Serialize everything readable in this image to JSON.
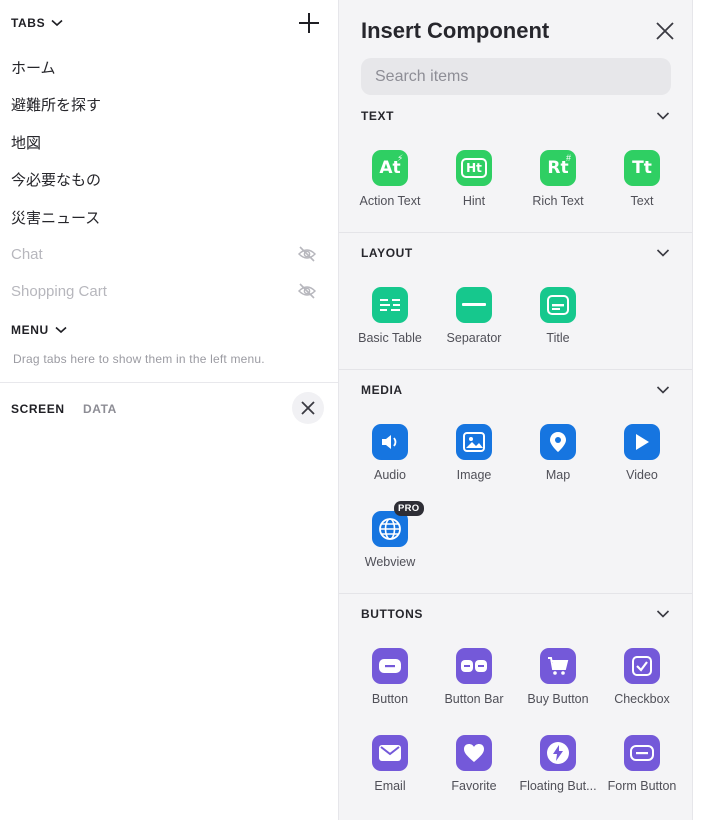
{
  "left": {
    "tabs_label": "TABS",
    "tabs": [
      {
        "label": "ホーム",
        "hidden": false
      },
      {
        "label": "避難所を探す",
        "hidden": false
      },
      {
        "label": "地図",
        "hidden": false
      },
      {
        "label": "今必要なもの",
        "hidden": false
      },
      {
        "label": "災害ニュース",
        "hidden": false
      },
      {
        "label": "Chat",
        "hidden": true,
        "icon": "eye-off-icon"
      },
      {
        "label": "Shopping Cart",
        "hidden": true,
        "icon": "eye-off-icon"
      }
    ],
    "menu_label": "MENU",
    "menu_hint": "Drag tabs here to show them in the left menu.",
    "screen_tab": "SCREEN",
    "data_tab": "DATA"
  },
  "panel": {
    "title": "Insert Component",
    "search_placeholder": "Search items",
    "categories": [
      {
        "name": "TEXT",
        "items": [
          {
            "label": "Action Text",
            "icon": "action-text-icon",
            "color": "#2fcf63"
          },
          {
            "label": "Hint",
            "icon": "hint-icon",
            "color": "#2fcf63"
          },
          {
            "label": "Rich Text",
            "icon": "rich-text-icon",
            "color": "#2fcf63"
          },
          {
            "label": "Text",
            "icon": "text-icon",
            "color": "#2fcf63"
          }
        ]
      },
      {
        "name": "LAYOUT",
        "items": [
          {
            "label": "Basic Table",
            "icon": "basic-table-icon",
            "color": "#16c88d"
          },
          {
            "label": "Separator",
            "icon": "separator-icon",
            "color": "#16c88d"
          },
          {
            "label": "Title",
            "icon": "title-icon",
            "color": "#16c88d"
          }
        ]
      },
      {
        "name": "MEDIA",
        "items": [
          {
            "label": "Audio",
            "icon": "speaker-icon",
            "color": "#1675e0"
          },
          {
            "label": "Image",
            "icon": "image-icon",
            "color": "#1675e0"
          },
          {
            "label": "Map",
            "icon": "map-pin-icon",
            "color": "#1675e0"
          },
          {
            "label": "Video",
            "icon": "play-icon",
            "color": "#1675e0"
          },
          {
            "label": "Webview",
            "icon": "globe-icon",
            "color": "#1675e0",
            "badge": "PRO"
          }
        ]
      },
      {
        "name": "BUTTONS",
        "items": [
          {
            "label": "Button",
            "icon": "button-icon",
            "color": "#7459d9"
          },
          {
            "label": "Button Bar",
            "icon": "button-bar-icon",
            "color": "#7459d9"
          },
          {
            "label": "Buy Button",
            "icon": "cart-icon",
            "color": "#7459d9"
          },
          {
            "label": "Checkbox",
            "icon": "checkbox-icon",
            "color": "#7459d9"
          },
          {
            "label": "Email",
            "icon": "email-icon",
            "color": "#7459d9"
          },
          {
            "label": "Favorite",
            "icon": "heart-icon",
            "color": "#7459d9"
          },
          {
            "label": "Floating But...",
            "icon": "lightning-icon",
            "color": "#7459d9"
          },
          {
            "label": "Form Button",
            "icon": "form-button-icon",
            "color": "#7459d9"
          }
        ]
      }
    ]
  }
}
